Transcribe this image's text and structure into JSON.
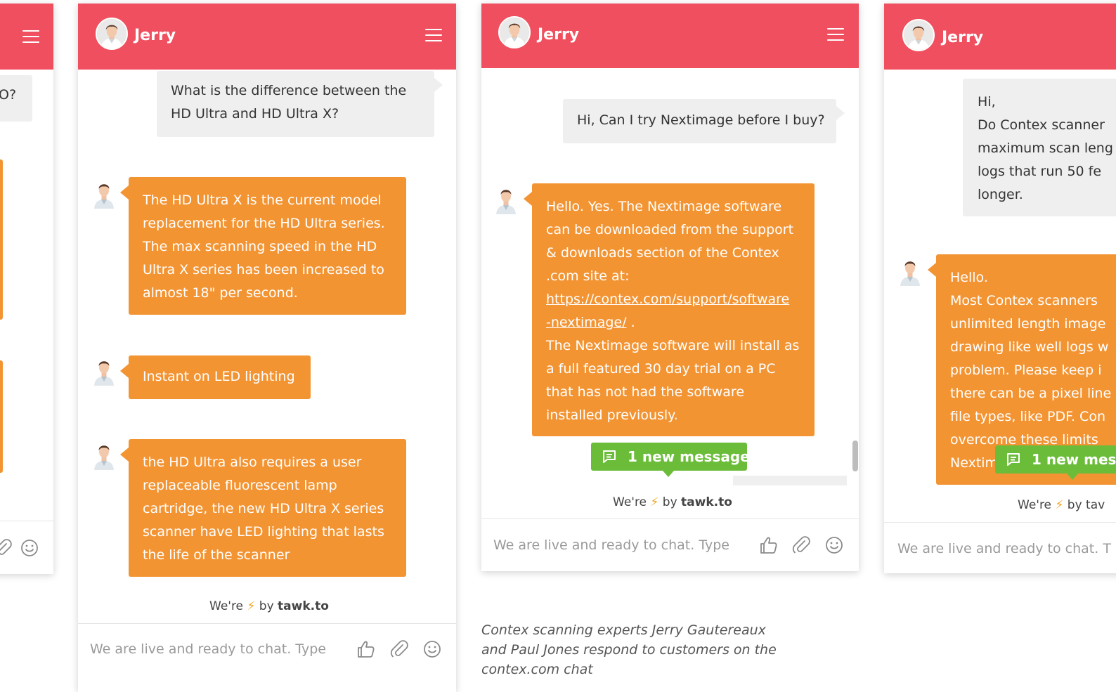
{
  "colors": {
    "header": "#ef4f5f",
    "agent_bubble": "#f39433",
    "user_bubble": "#efefef",
    "new_message": "#6bbd39"
  },
  "panel1": {
    "user_fragment": "O?",
    "placeholder_icons": [
      "attach-icon",
      "smiley-icon"
    ]
  },
  "panel2": {
    "agent_name": "Jerry",
    "user_message": [
      "What is the difference between the",
      "HD Ultra and HD Ultra X?"
    ],
    "agent_messages": [
      [
        "The HD Ultra X is the current model",
        "replacement for the HD Ultra series.",
        "The max scanning speed in the HD",
        "Ultra X series has been increased to",
        "almost 18\" per second."
      ],
      [
        "Instant on LED lighting"
      ],
      [
        "the HD Ultra also requires a user",
        "replaceable fluorescent lamp",
        "cartridge, the new HD Ultra X series",
        "scanner have LED lighting that lasts",
        "the life of the scanner"
      ]
    ],
    "powered_pre": "We're",
    "powered_post": "by",
    "powered_brand": "tawk.to",
    "input_placeholder": "We are live and ready to chat. Type"
  },
  "panel3": {
    "agent_name": "Jerry",
    "user_message": "Hi, Can I try Nextimage before I buy?",
    "agent_message": [
      "Hello. Yes. The Nextimage software",
      "can be downloaded from the support",
      "& downloads section of the Contex",
      ".com site at:"
    ],
    "agent_link": [
      " https://contex.com/support/software",
      "-nextimage/"
    ],
    "agent_link_suffix": " .",
    "agent_message_after": [
      "The Nextimage software will install as",
      "a full featured 30 day trial on a PC",
      "that has not had the software",
      "installed previously."
    ],
    "new_message": "1 new message",
    "powered_pre": "We're",
    "powered_post": "by",
    "powered_brand": "tawk.to",
    "input_placeholder": "We are live and ready to chat. Type"
  },
  "panel4": {
    "agent_name": "Jerry",
    "user_message": [
      "Hi,",
      "Do Contex scanner",
      "maximum scan leng",
      "logs that run 50 fe",
      "longer."
    ],
    "agent_message": [
      "Hello.",
      "Most Contex scanners",
      "unlimited length image",
      "drawing like well logs w",
      "problem. Please keep i",
      "there can be a pixel line",
      "file types, like PDF. Con",
      "overcome these limits",
      "Nextim"
    ],
    "new_message": "1 new mes",
    "powered_pre": "We're",
    "powered_post": "by tav",
    "input_placeholder": "We are live and ready to chat. T"
  },
  "caption": [
    "Contex scanning experts Jerry Gautereaux",
    "and Paul Jones respond to customers on the",
    "contex.com chat"
  ]
}
